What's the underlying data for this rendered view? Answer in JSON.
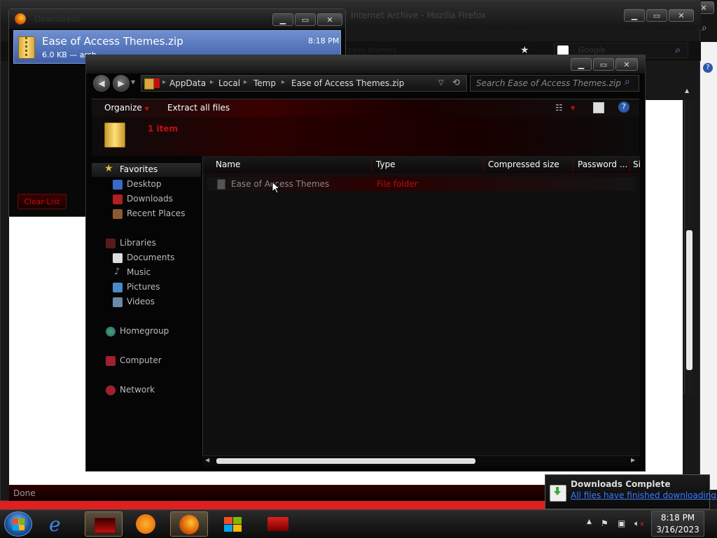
{
  "firefox": {
    "title": "Internet Archive - Mozilla Firefox",
    "url_fragment": "ccess-themes",
    "search_placeholder": "Google",
    "status": "Done"
  },
  "downloads": {
    "title": "Downloads",
    "item": {
      "filename": "Ease of Access Themes.zip",
      "meta": "6.0 KB — arch",
      "time": "8:18 PM"
    },
    "clear_list": "Clear List"
  },
  "explorer": {
    "breadcrumb": [
      "AppData",
      "Local",
      "Temp",
      "Ease of Access Themes.zip"
    ],
    "search_placeholder": "Search Ease of Access Themes.zip",
    "commands": {
      "organize": "Organize",
      "extract_all": "Extract all files"
    },
    "details": {
      "count": "1 item"
    },
    "nav": {
      "favorites": "Favorites",
      "desktop": "Desktop",
      "downloads": "Downloads",
      "recent_places": "Recent Places",
      "libraries": "Libraries",
      "documents": "Documents",
      "music": "Music",
      "pictures": "Pictures",
      "videos": "Videos",
      "homegroup": "Homegroup",
      "computer": "Computer",
      "network": "Network"
    },
    "columns": {
      "name": "Name",
      "type": "Type",
      "compressed_size": "Compressed size",
      "password": "Password ...",
      "size": "Si"
    },
    "rows": [
      {
        "name": "Ease of Access Themes",
        "type": "File folder"
      }
    ]
  },
  "notification": {
    "title": "Downloads Complete",
    "body": "All files have finished downloading."
  },
  "taskbar": {
    "time": "8:18 PM",
    "date": "3/16/2023"
  },
  "colors": {
    "accent_red": "#c01010",
    "link_blue": "#3a7cff",
    "selection_blue": "#4d6fb8"
  }
}
